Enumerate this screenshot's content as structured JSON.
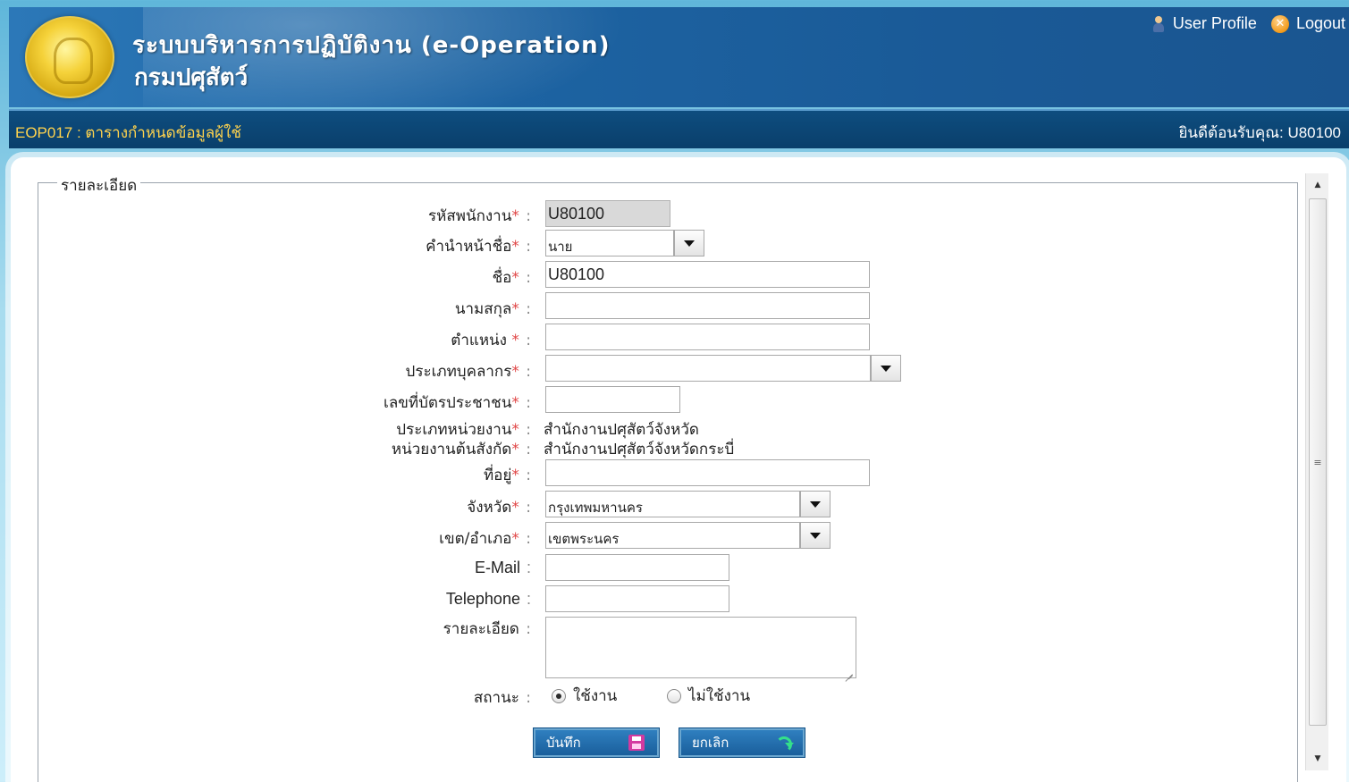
{
  "header": {
    "title_line1": "ระบบบริหารการปฏิบัติงาน (e-Operation)",
    "title_line2": "กรมปศุสัตว์",
    "user_profile": "User Profile",
    "logout": "Logout"
  },
  "titlebar": {
    "page_code": "EOP017 : ตารางกำหนดข้อมูลผู้ใช้",
    "welcome": "ยินดีต้อนรับคุณ: U80100"
  },
  "form": {
    "legend": "รายละเอียด",
    "employee_id": {
      "label": "รหัสพนักงาน",
      "value": "U80100"
    },
    "prefix": {
      "label": "คำนำหน้าชื่อ",
      "value": "นาย"
    },
    "first_name": {
      "label": "ชื่อ",
      "value": "U80100"
    },
    "last_name": {
      "label": "นามสกุล",
      "value": ""
    },
    "position": {
      "label": "ตำแหน่ง ",
      "value": ""
    },
    "staff_type": {
      "label": "ประเภทบุคลากร",
      "value": ""
    },
    "citizen_id": {
      "label": "เลขที่บัตรประชาชน",
      "value": ""
    },
    "unit_type": {
      "label": "ประเภทหน่วยงาน",
      "value": "สำนักงานปศุสัตว์จังหวัด"
    },
    "parent_unit": {
      "label": "หน่วยงานต้นสังกัด",
      "value": "สำนักงานปศุสัตว์จังหวัดกระบี่"
    },
    "address": {
      "label": "ที่อยู่",
      "value": ""
    },
    "province": {
      "label": "จังหวัด",
      "value": "กรุงเทพมหานคร"
    },
    "district": {
      "label": "เขต/อำเภอ",
      "value": "เขตพระนคร"
    },
    "email": {
      "label": "E-Mail",
      "value": ""
    },
    "telephone": {
      "label": "Telephone",
      "value": ""
    },
    "details": {
      "label": "รายละเอียด",
      "value": ""
    },
    "status": {
      "label": "สถานะ",
      "active": "ใช้งาน",
      "inactive": "ไม่ใช้งาน",
      "selected": "active"
    },
    "required_mark": "*",
    "colon": ":"
  },
  "buttons": {
    "save": "บันทึก",
    "cancel": "ยกเลิก"
  },
  "icons": [
    "user-icon",
    "logout-icon",
    "emblem-logo",
    "chevron-down-icon",
    "save-icon",
    "undo-icon",
    "scroll-up-icon",
    "scroll-down-icon"
  ]
}
